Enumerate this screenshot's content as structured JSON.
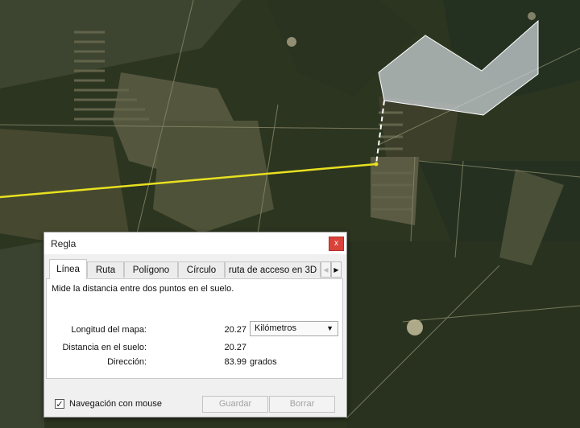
{
  "dialog": {
    "title": "Regla",
    "close_glyph": "x",
    "tabs": [
      {
        "label": "Línea",
        "active": true
      },
      {
        "label": "Ruta"
      },
      {
        "label": "Polígono"
      },
      {
        "label": "Círculo"
      },
      {
        "label": "ruta de acceso en 3D"
      }
    ],
    "tab_scroll_left_glyph": "◀",
    "tab_scroll_right_glyph": "▶",
    "description": "Mide la distancia entre dos puntos en el suelo.",
    "map_length": {
      "label": "Longitud del mapa:",
      "value": "20.27"
    },
    "unit_select": {
      "selected": "Kilómetros",
      "arrow_glyph": "▼"
    },
    "ground_distance": {
      "label": "Distancia en el suelo:",
      "value": "20.27"
    },
    "heading": {
      "label": "Dirección:",
      "value": "83.99",
      "unit": "grados"
    },
    "mouse_navigation": {
      "label": "Navegación con mouse",
      "checked": true,
      "check_glyph": "✓"
    },
    "save_label": "Guardar",
    "clear_label": "Borrar"
  },
  "map": {
    "ruler_line_color": "#e8e020",
    "polygon_fill": "#c9d2d6",
    "terrain_base": "#2c3520"
  }
}
